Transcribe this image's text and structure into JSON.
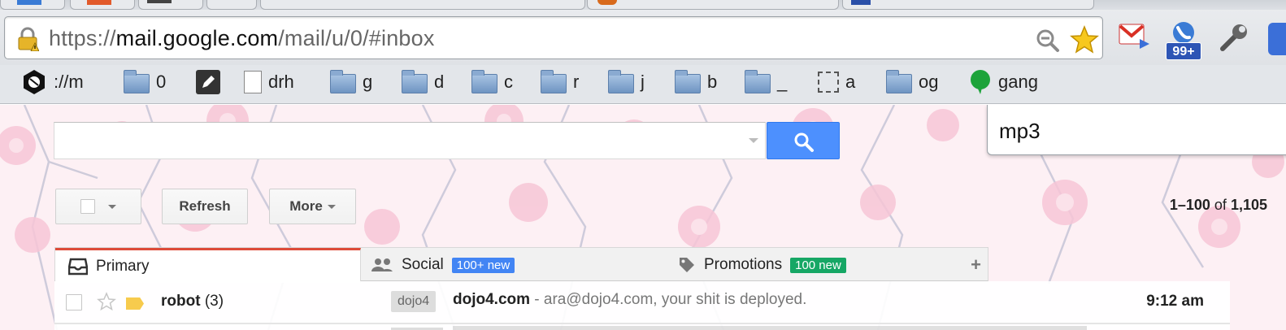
{
  "browser": {
    "url_scheme": "https://",
    "url_host": "mail.google.com",
    "url_path": "/mail/u/0/#inbox",
    "extensions": {
      "voice_badge": "99+"
    }
  },
  "bookmarks": [
    {
      "label": "://m",
      "icon": "github-icon"
    },
    {
      "label": "0",
      "icon": "folder-icon"
    },
    {
      "label": "",
      "icon": "pencil-icon"
    },
    {
      "label": "drh",
      "icon": "page-icon"
    },
    {
      "label": "g",
      "icon": "folder-icon"
    },
    {
      "label": "d",
      "icon": "folder-icon"
    },
    {
      "label": "c",
      "icon": "folder-icon"
    },
    {
      "label": "r",
      "icon": "folder-icon"
    },
    {
      "label": "j",
      "icon": "folder-icon"
    },
    {
      "label": "b",
      "icon": "folder-icon"
    },
    {
      "label": "_",
      "icon": "folder-icon"
    },
    {
      "label": "a",
      "icon": "selection-icon"
    },
    {
      "label": "og",
      "icon": "folder-icon"
    },
    {
      "label": "gang",
      "icon": "chat-bubble-icon"
    }
  ],
  "find": {
    "query": "mp3"
  },
  "gmail": {
    "search_value": "",
    "toolbar": {
      "refresh_label": "Refresh",
      "more_label": "More"
    },
    "pager": {
      "range": "1–100",
      "of": "of",
      "total": "1,105"
    },
    "tabs": [
      {
        "label": "Primary",
        "badge": ""
      },
      {
        "label": "Social",
        "badge": "100+ new",
        "badge_color": "#4285f4"
      },
      {
        "label": "Promotions",
        "badge": "100 new",
        "badge_color": "#16a765"
      }
    ],
    "accent_color": "#dd4b39",
    "search_button_color": "#4d90fe",
    "messages": [
      {
        "sender": "robot",
        "count": "(3)",
        "label": "dojo4",
        "subject": "dojo4.com",
        "snippet": " - ara@dojo4.com, your shit is deployed.",
        "time": "9:12 am"
      }
    ]
  }
}
